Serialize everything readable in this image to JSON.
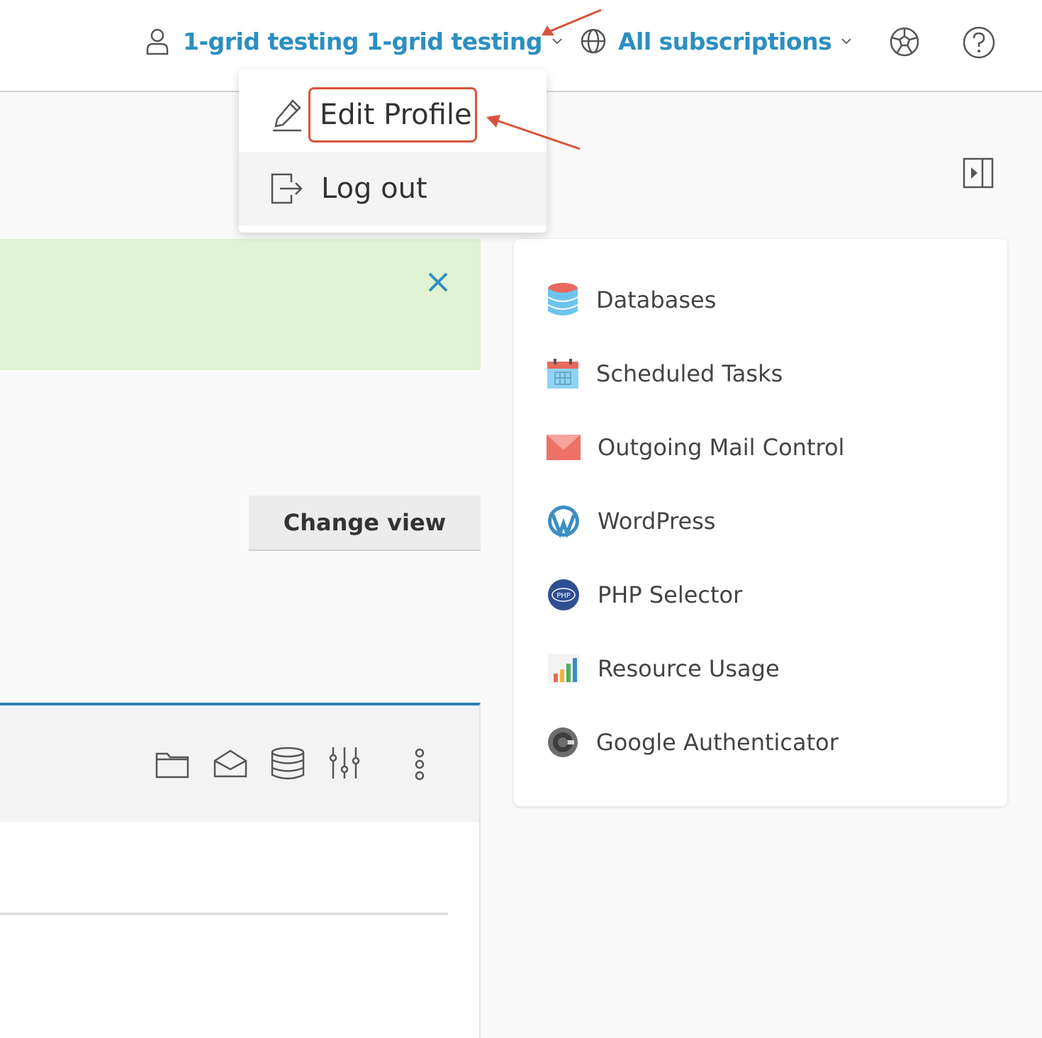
{
  "header": {
    "user_label": "1-grid testing 1-grid testing",
    "subscriptions_label": "All subscriptions"
  },
  "user_dropdown": {
    "items": [
      {
        "label": "Edit Profile",
        "icon": "pencil-icon"
      },
      {
        "label": "Log out",
        "icon": "logout-icon"
      }
    ]
  },
  "main": {
    "change_view_label": "Change view",
    "toolbar_icons": [
      "folder-icon",
      "mail-icon",
      "database-icon",
      "sliders-icon",
      "more-vertical-icon"
    ]
  },
  "sidebar": {
    "items": [
      {
        "label": "Databases",
        "icon": "databases-icon"
      },
      {
        "label": "Scheduled Tasks",
        "icon": "calendar-icon"
      },
      {
        "label": "Outgoing Mail Control",
        "icon": "mail-envelope-icon"
      },
      {
        "label": "WordPress",
        "icon": "wordpress-icon"
      },
      {
        "label": "PHP Selector",
        "icon": "php-icon"
      },
      {
        "label": "Resource Usage",
        "icon": "bar-chart-icon"
      },
      {
        "label": "Google Authenticator",
        "icon": "google-authenticator-icon"
      }
    ]
  },
  "colors": {
    "accent": "#2c8fc1",
    "notice_bg": "#dff2d1",
    "annotation": "#d9533c",
    "panel_border": "#2d7fb8"
  }
}
